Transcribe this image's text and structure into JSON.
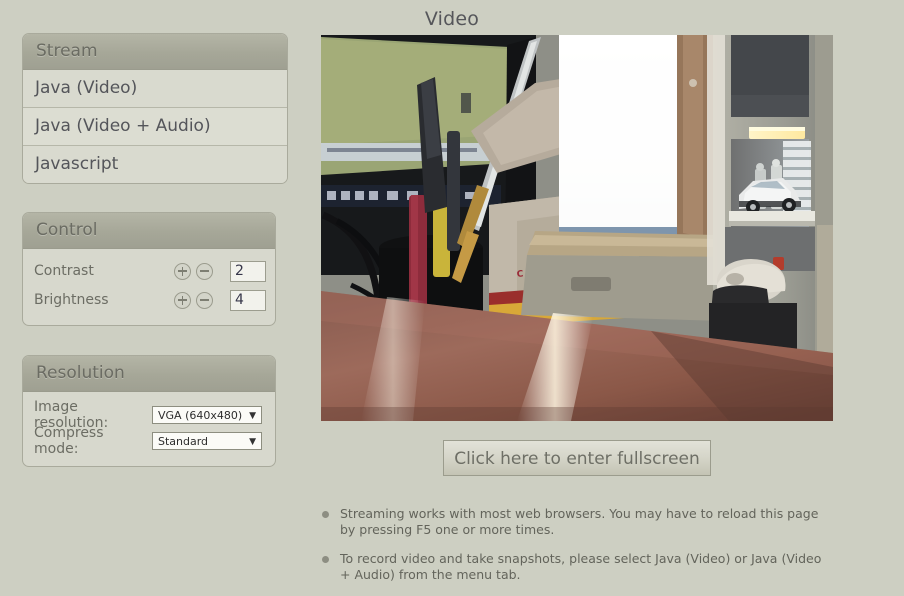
{
  "page": {
    "title": "Video",
    "background_color": "#cdcfc2"
  },
  "stream_panel": {
    "header": "Stream",
    "items": [
      {
        "label": "Java (Video)"
      },
      {
        "label": "Java (Video + Audio)"
      },
      {
        "label": "Javascript"
      }
    ]
  },
  "control_panel": {
    "header": "Control",
    "rows": [
      {
        "label": "Contrast",
        "value": "2",
        "increase_icon": "plus-circle-icon",
        "decrease_icon": "minus-circle-icon"
      },
      {
        "label": "Brightness",
        "value": "4",
        "increase_icon": "plus-circle-icon",
        "decrease_icon": "minus-circle-icon"
      }
    ]
  },
  "resolution_panel": {
    "header": "Resolution",
    "image_resolution": {
      "label": "Image resolution:",
      "value": "VGA (640x480)",
      "arrow_icon": "chevron-down-icon"
    },
    "compress_mode": {
      "label": "Compress mode:",
      "value": "Standard",
      "arrow_icon": "chevron-down-icon"
    }
  },
  "video": {
    "alt": "Live camera view of an office desk with monitor, pen holder, CCTV box, window and shelf with a model car"
  },
  "fullscreen_button": {
    "label": "Click here to enter fullscreen"
  },
  "notes": [
    {
      "text": "Streaming works with most web browsers. You may have to reload this page by pressing F5 one or more times."
    },
    {
      "text": "To record video and take snapshots, please select Java (Video) or Java (Video + Audio) from the menu tab."
    }
  ]
}
